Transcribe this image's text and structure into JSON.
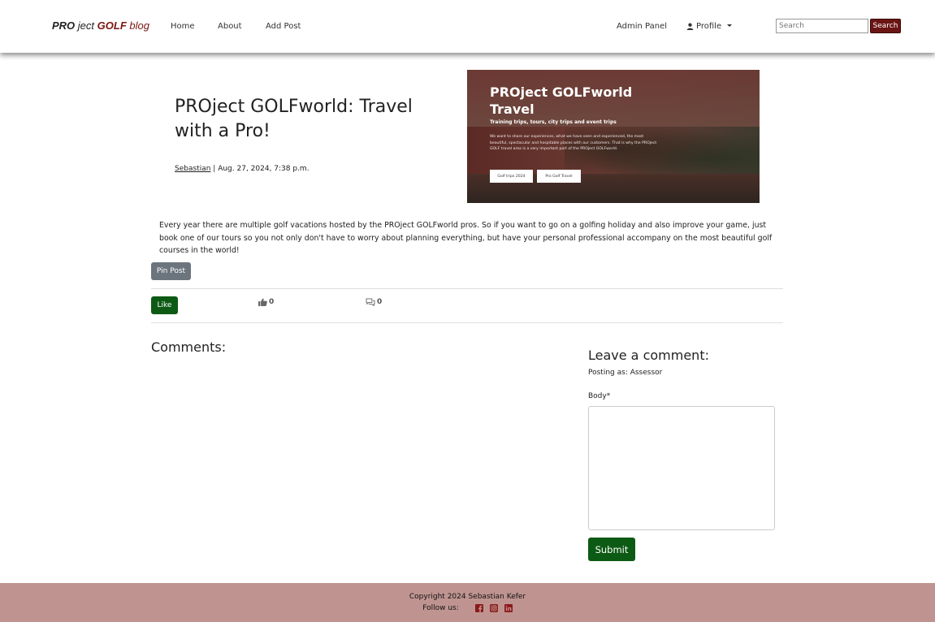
{
  "navbar": {
    "brand_pro": "PRO",
    "brand_ject": "ject",
    "brand_golf": "GOLF",
    "brand_blog": "blog",
    "links": [
      "Home",
      "About",
      "Add Post"
    ],
    "admin_panel": "Admin Panel",
    "profile": "Profile",
    "search_placeholder": "Search",
    "search_button": "Search"
  },
  "post": {
    "title": "PROject GOLFworld: Travel with a Pro!",
    "author": "Sebastian",
    "date": "| Aug. 27, 2024, 7:38 p.m.",
    "body": "Every year there are multiple golf vacations hosted by the PROject GOLFworld pros. So if you want to go on a golfing holiday and also improve your game, just book one of our tours so you not only don't have to worry about planning everything, but have your personal professional accompany on the most beautiful golf courses in the world!"
  },
  "hero": {
    "title": "PROject GOLFworld Travel",
    "subtitle": "Training trips, tours, city trips and event trips",
    "text": "We want to share our experiences, what we have seen and experienced, the most beautiful, spectacular and hospitable places with our customers. That is why the PROject GOLF travel area is a very important part of the PROject GOLFworld.",
    "button1": "Golf trips 2024",
    "button2": "Pro Golf Travel"
  },
  "actions": {
    "pin_post": "Pin Post",
    "like": "Like",
    "like_count": "0",
    "comment_count": "0"
  },
  "comments": {
    "heading": "Comments:",
    "leave_heading": "Leave a comment:",
    "posting_as": "Posting as: Assessor",
    "body_label": "Body*",
    "submit": "Submit"
  },
  "footer": {
    "copyright": "Copyright 2024 Sebastian Kefer",
    "follow": "Follow us:",
    "icons": [
      "facebook-icon",
      "instagram-icon",
      "linkedin-icon"
    ]
  },
  "colors": {
    "brand_red": "#7a1710",
    "search_button": "#6b1414",
    "green_button": "#0d5a14",
    "footer_bg": "#bf9490"
  }
}
